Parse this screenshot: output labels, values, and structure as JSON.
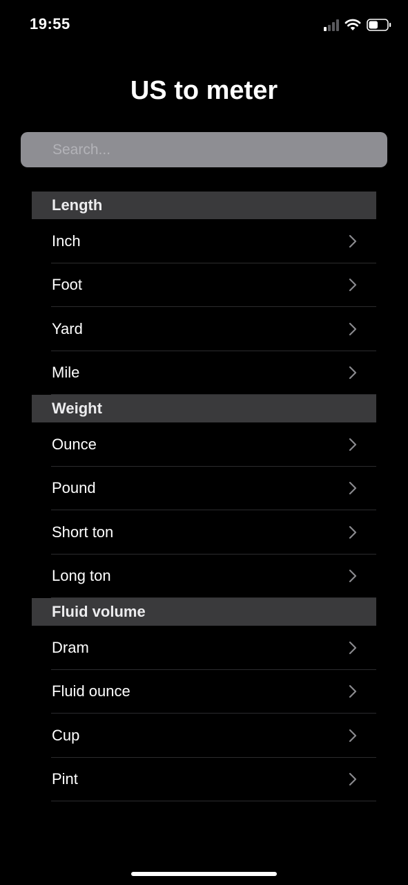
{
  "status_bar": {
    "time": "19:55",
    "signal_icon": "cellular-signal-icon",
    "wifi_icon": "wifi-icon",
    "battery_icon": "battery-icon",
    "battery_level": 0.5
  },
  "header": {
    "title": "US to meter"
  },
  "search": {
    "placeholder": "Search..."
  },
  "colors": {
    "background": "#000000",
    "section_header": "#3a3a3c",
    "search_field": "#8e8e93",
    "separator": "#2c2c2e",
    "chevron": "#8a8a8e"
  },
  "sections": [
    {
      "title": "Length",
      "items": [
        {
          "label": "Inch"
        },
        {
          "label": "Foot"
        },
        {
          "label": "Yard"
        },
        {
          "label": "Mile"
        }
      ]
    },
    {
      "title": "Weight",
      "items": [
        {
          "label": "Ounce"
        },
        {
          "label": "Pound"
        },
        {
          "label": "Short ton"
        },
        {
          "label": "Long ton"
        }
      ]
    },
    {
      "title": "Fluid volume",
      "items": [
        {
          "label": "Dram"
        },
        {
          "label": "Fluid ounce"
        },
        {
          "label": "Cup"
        },
        {
          "label": "Pint"
        }
      ]
    }
  ]
}
